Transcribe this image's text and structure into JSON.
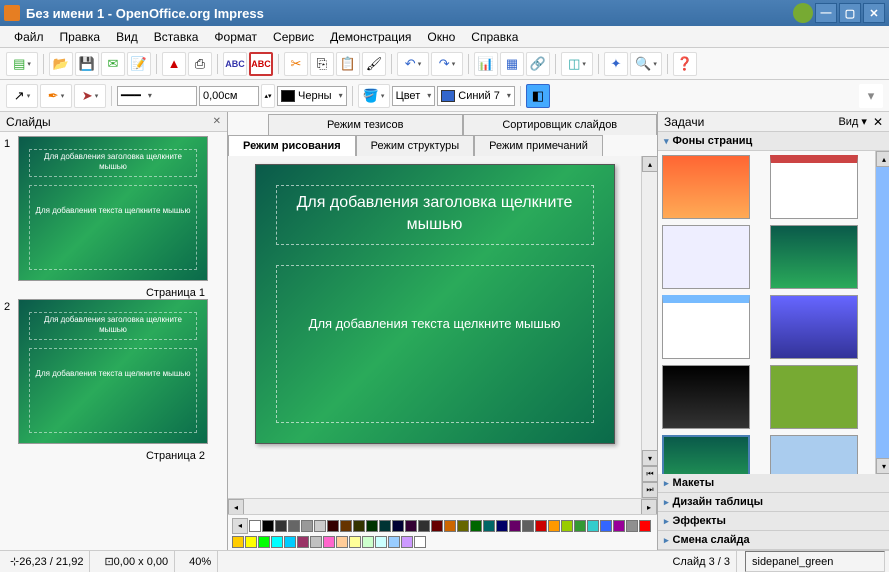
{
  "window": {
    "title": "Без имени 1 - OpenOffice.org Impress"
  },
  "menu": [
    "Файл",
    "Правка",
    "Вид",
    "Вставка",
    "Формат",
    "Сервис",
    "Демонстрация",
    "Окно",
    "Справка"
  ],
  "toolbar2": {
    "line_width": "0,00см",
    "line_color_label": "Черны",
    "fill_type_label": "Цвет",
    "fill_color_label": "Синий 7"
  },
  "left_panel": {
    "title": "Слайды",
    "slides": [
      {
        "num": "1",
        "title": "Для добавления заголовка щелкните мышью",
        "body": "Для добавления текста щелкните мышью",
        "label": "Страница 1"
      },
      {
        "num": "2",
        "title": "Для добавления заголовка щелкните мышью",
        "body": "Для добавления текста щелкните мышью",
        "label": "Страница 2"
      }
    ]
  },
  "center": {
    "tabs_top": [
      "Режим тезисов",
      "Сортировщик слайдов"
    ],
    "tabs_main": [
      "Режим рисования",
      "Режим структуры",
      "Режим примечаний"
    ],
    "active_tab": 0,
    "slide": {
      "title": "Для добавления заголовка щелкните мышью",
      "body": "Для добавления текста щелкните мышью"
    }
  },
  "palette": [
    "#fff",
    "#000",
    "#333",
    "#666",
    "#999",
    "#ccc",
    "#300",
    "#630",
    "#330",
    "#030",
    "#033",
    "#003",
    "#303",
    "#303030",
    "#600",
    "#c60",
    "#660",
    "#060",
    "#066",
    "#006",
    "#606",
    "#606060",
    "#c00",
    "#f90",
    "#9c0",
    "#393",
    "#3cc",
    "#36f",
    "#909",
    "#909090",
    "#f00",
    "#fc0",
    "#ff0",
    "#0f0",
    "#0ff",
    "#0cf",
    "#936",
    "#c0c0c0",
    "#f6c",
    "#fc9",
    "#ff9",
    "#cfc",
    "#cff",
    "#9cf",
    "#c9f",
    "#fff"
  ],
  "right_panel": {
    "title": "Задачи",
    "view_label": "Вид",
    "sections": {
      "backgrounds": "Фоны страниц",
      "layouts": "Макеты",
      "table_design": "Дизайн таблицы",
      "effects": "Эффекты",
      "transitions": "Смена слайда"
    },
    "templates": [
      {
        "bg": "linear-gradient(#f63,#fa5)"
      },
      {
        "bg": "#fff",
        "accent": "#c44"
      },
      {
        "bg": "#eef"
      },
      {
        "bg": "linear-gradient(#0a5a4a,#2aaa5a)"
      },
      {
        "bg": "#fff",
        "accent": "#7bf"
      },
      {
        "bg": "linear-gradient(#66f,#339)"
      },
      {
        "bg": "linear-gradient(#000,#333)"
      },
      {
        "bg": "#7a3",
        "img": true
      },
      {
        "bg": "linear-gradient(#0a5a4a,#2aaa5a)",
        "sel": true
      },
      {
        "bg": "#ace"
      },
      {
        "bg": "linear-gradient(#024,#048)"
      },
      {
        "bg": "#dec"
      }
    ]
  },
  "statusbar": {
    "coords": "26,23 / 21,92",
    "size": "0,00 x 0,00",
    "zoom": "40%",
    "slide_info": "Слайд 3 / 3",
    "template": "sidepanel_green"
  }
}
